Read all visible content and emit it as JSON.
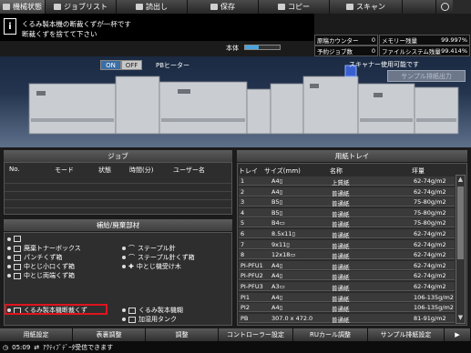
{
  "tabs": [
    {
      "label": "機械状態",
      "icon": "printer-icon"
    },
    {
      "label": "ジョブリスト",
      "icon": "list-icon"
    },
    {
      "label": "読出し",
      "icon": "folder-icon"
    },
    {
      "label": "保存",
      "icon": "save-icon"
    },
    {
      "label": "コピー",
      "icon": "copy-icon"
    },
    {
      "label": "スキャン",
      "icon": "scan-icon"
    }
  ],
  "message": {
    "line1": "くるみ製本機の断裁くずが一杯です",
    "line2": "断裁くずを捨てて下さい"
  },
  "main_unit": {
    "label": "本体",
    "level": 0.4
  },
  "counters": {
    "original_counter_label": "原稿カウンター",
    "original_counter_value": "0",
    "memory_label": "メモリー残量",
    "memory_value": "99.997%",
    "reserved_label": "予約ジョブ数",
    "reserved_value": "0",
    "filesystem_label": "ファイルシステム残量",
    "filesystem_value": "99.414%"
  },
  "pb_heater": {
    "on": "ON",
    "off": "OFF",
    "label": "PBヒーター"
  },
  "scanner_status": "スキャナー使用可能です",
  "sample_button": "サンプル排紙出力",
  "job_panel": {
    "title": "ジョブ",
    "columns": [
      "No.",
      "モード",
      "状態",
      "時間(分)",
      "ユーザー名"
    ]
  },
  "supplies_panel": {
    "title": "補給/廃棄部材",
    "items": [
      {
        "label": "",
        "icon": "toner-icon"
      },
      {
        "label": "廃棄トナーボックス",
        "icon": "waste-toner-icon"
      },
      {
        "label": "パンチくず箱",
        "icon": "punch-waste-icon"
      },
      {
        "label": "中とじ小口くず箱",
        "icon": "trim-waste-icon"
      },
      {
        "label": "中とじ両端くず箱",
        "icon": "trim-waste-icon"
      },
      {
        "label": "くるみ製本機断裁くず",
        "icon": "bind-waste-icon"
      },
      {
        "label": "ステープル針",
        "icon": "staple-icon"
      },
      {
        "label": "ステープル針くず箱",
        "icon": "staple-waste-icon"
      },
      {
        "label": "中とじ機受け木",
        "icon": "saddle-icon"
      },
      {
        "label": "くるみ製本機糊",
        "icon": "glue-icon"
      },
      {
        "label": "加湿用タンク",
        "icon": "tank-icon"
      }
    ]
  },
  "tray_panel": {
    "title": "用紙トレイ",
    "columns": [
      "トレイ",
      "サイズ(mm)",
      "名称",
      "坪量"
    ],
    "rows": [
      [
        "1",
        "A4▯",
        "上質紙",
        "62-74g/m2"
      ],
      [
        "2",
        "A4▯",
        "普通紙",
        "62-74g/m2"
      ],
      [
        "3",
        "B5▯",
        "普通紙",
        "75-80g/m2"
      ],
      [
        "4",
        "B5▯",
        "普通紙",
        "75-80g/m2"
      ],
      [
        "5",
        "B4▭",
        "普通紙",
        "75-80g/m2"
      ],
      [
        "6",
        "8.5x11▯",
        "普通紙",
        "62-74g/m2"
      ],
      [
        "7",
        "9x11▯",
        "普通紙",
        "62-74g/m2"
      ],
      [
        "8",
        "12x18▭",
        "普通紙",
        "62-74g/m2"
      ],
      [
        "PI-PFU1",
        "A4▯",
        "普通紙",
        "62-74g/m2"
      ],
      [
        "PI-PFU2",
        "A4▯",
        "普通紙",
        "62-74g/m2"
      ],
      [
        "PI-PFU3",
        "A3▭",
        "普通紙",
        "62-74g/m2"
      ],
      [
        "PI1",
        "A4▯",
        "普通紙",
        "106-135g/m2"
      ],
      [
        "PI2",
        "A4▯",
        "普通紙",
        "106-135g/m2"
      ],
      [
        "PB",
        "307.0 x 472.0",
        "普通紙",
        "81-91g/m2"
      ]
    ]
  },
  "bottom_buttons": [
    "用紙設定",
    "表裏調整",
    "調整",
    "コントローラー設定",
    "RUカール調整",
    "サンプル排紙設定",
    "▶"
  ],
  "status": {
    "time": "05:09",
    "text": "ｱｸﾃｨﾌﾞﾃﾞｰﾀ受信できます"
  }
}
